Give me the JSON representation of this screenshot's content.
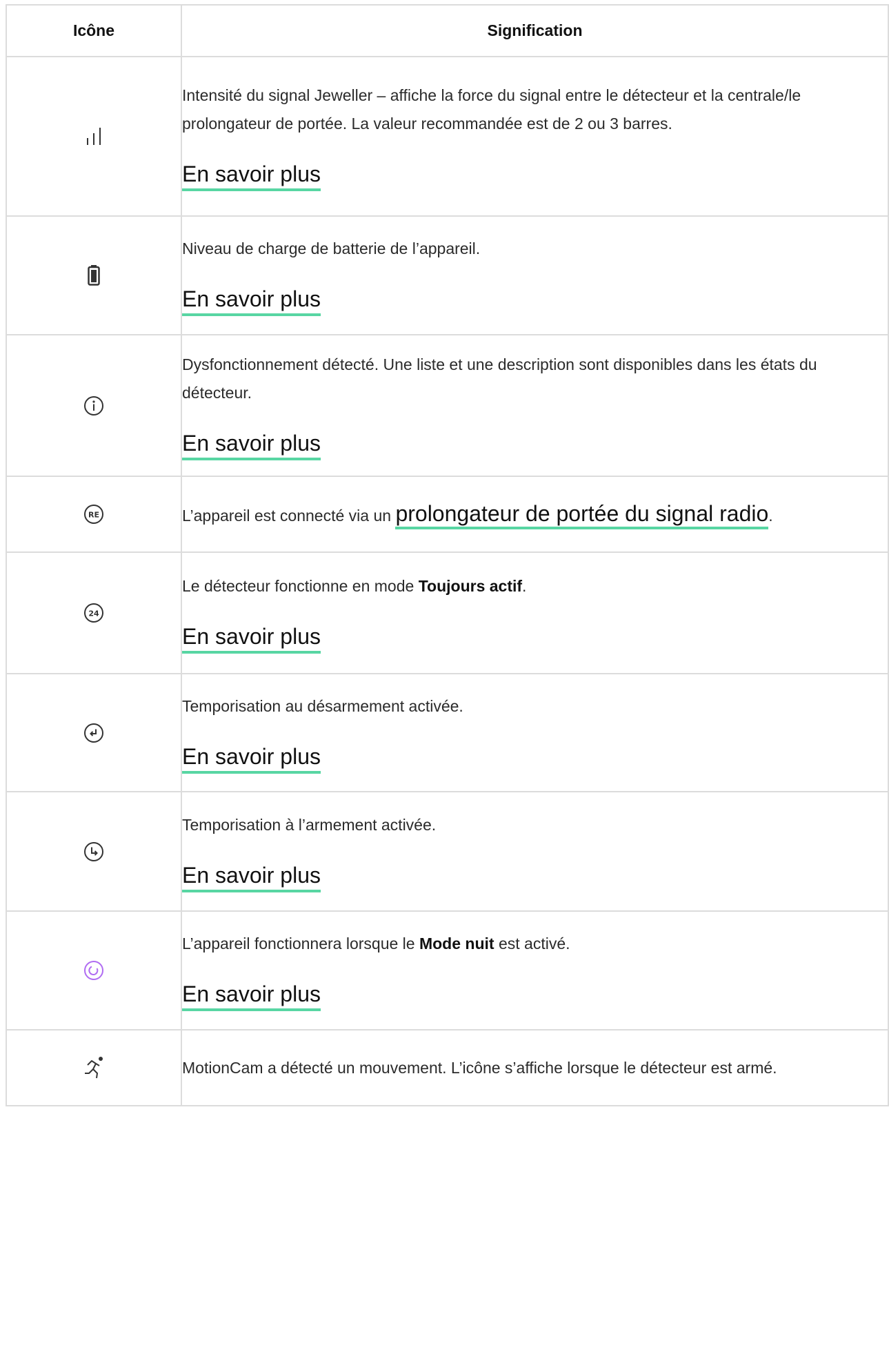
{
  "table": {
    "headers": {
      "icon": "Icône",
      "meaning": "Signification"
    },
    "more_label": "En savoir plus",
    "accent_color": "#58d6a3",
    "rows": [
      {
        "icon": "signal-strength-icon",
        "desc": "Intensité du signal Jeweller – affiche la force du signal entre le détecteur et la centrale/le prolongateur de portée. La valeur recommandée est de 2 ou 3 barres."
      },
      {
        "icon": "battery-icon",
        "desc": "Niveau de charge de batterie de l’appareil."
      },
      {
        "icon": "info-icon",
        "desc": "Dysfonctionnement détecté. Une liste et une description sont disponibles dans les états du détecteur."
      },
      {
        "icon": "range-extender-re-icon",
        "desc_before": "L’appareil est connecté via un ",
        "link": "prolongateur de portée du signal radio",
        "desc_after": "."
      },
      {
        "icon": "always-active-24-icon",
        "desc_before": "Le détecteur fonctionne en mode ",
        "bold": "Toujours actif",
        "desc_after": "."
      },
      {
        "icon": "entry-delay-icon",
        "desc": "Temporisation au désarmement activée."
      },
      {
        "icon": "exit-delay-icon",
        "desc": "Temporisation à l’armement activée."
      },
      {
        "icon": "night-mode-icon",
        "icon_color": "#b06cf2",
        "desc_before": "L’appareil fonctionnera lorsque le ",
        "bold": "Mode nuit",
        "desc_after": " est activé."
      },
      {
        "icon": "motion-detected-icon",
        "desc": "MotionCam a détecté un mouvement. L’icône s’affiche lorsque le détecteur est armé."
      }
    ]
  }
}
